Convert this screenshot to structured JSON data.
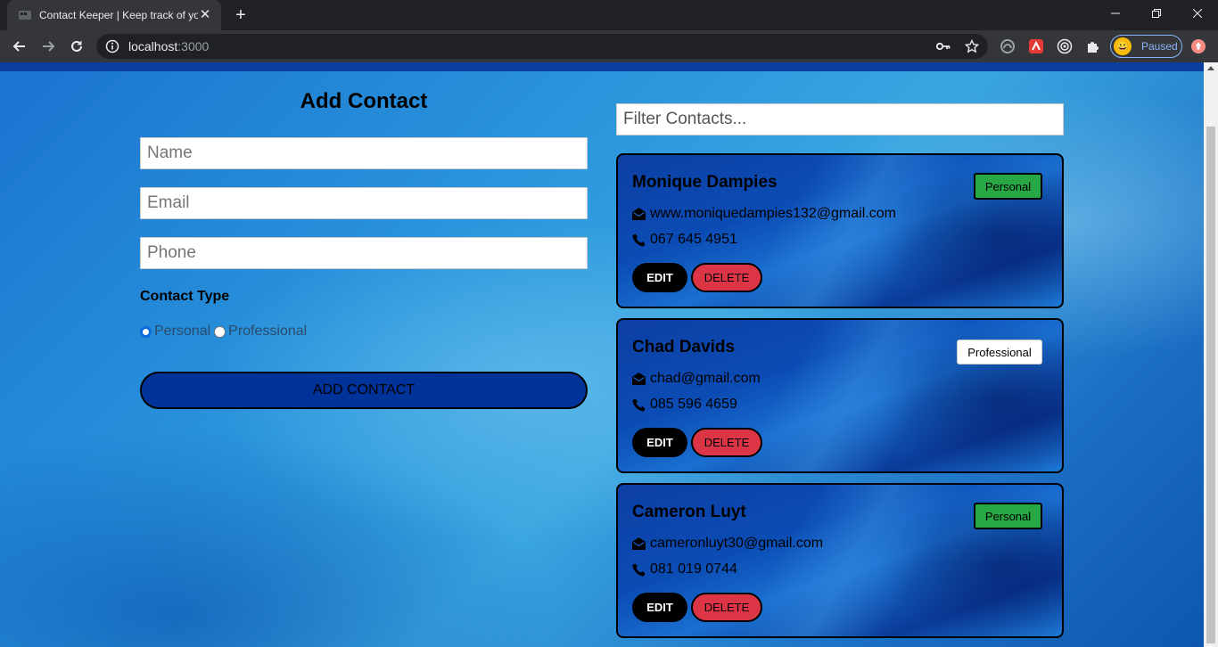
{
  "browser": {
    "tab_title": "Contact Keeper | Keep track of yo",
    "url_host": "localhost",
    "url_port": ":3000",
    "profile_label": "Paused"
  },
  "form": {
    "title": "Add Contact",
    "name_placeholder": "Name",
    "email_placeholder": "Email",
    "phone_placeholder": "Phone",
    "contact_type_label": "Contact Type",
    "type_options": [
      "Personal",
      "Professional"
    ],
    "selected_type": "Personal",
    "submit_label": "ADD CONTACT"
  },
  "filter": {
    "placeholder": "Filter Contacts..."
  },
  "contacts": [
    {
      "name": "Monique Dampies",
      "type": "Personal",
      "email": "www.moniquedampies132@gmail.com",
      "phone": "067 645 4951"
    },
    {
      "name": "Chad Davids",
      "type": "Professional",
      "email": "chad@gmail.com",
      "phone": "085 596 4659"
    },
    {
      "name": "Cameron Luyt",
      "type": "Personal",
      "email": "cameronluyt30@gmail.com",
      "phone": "081 019 0744"
    }
  ],
  "card_actions": {
    "edit_label": "EDIT",
    "delete_label": "DELETE"
  },
  "colors": {
    "personal_badge": "#28a745",
    "professional_badge": "#ffffff",
    "delete_button": "#dc3545",
    "submit_button": "#003399",
    "accent": "#0a6be0"
  }
}
